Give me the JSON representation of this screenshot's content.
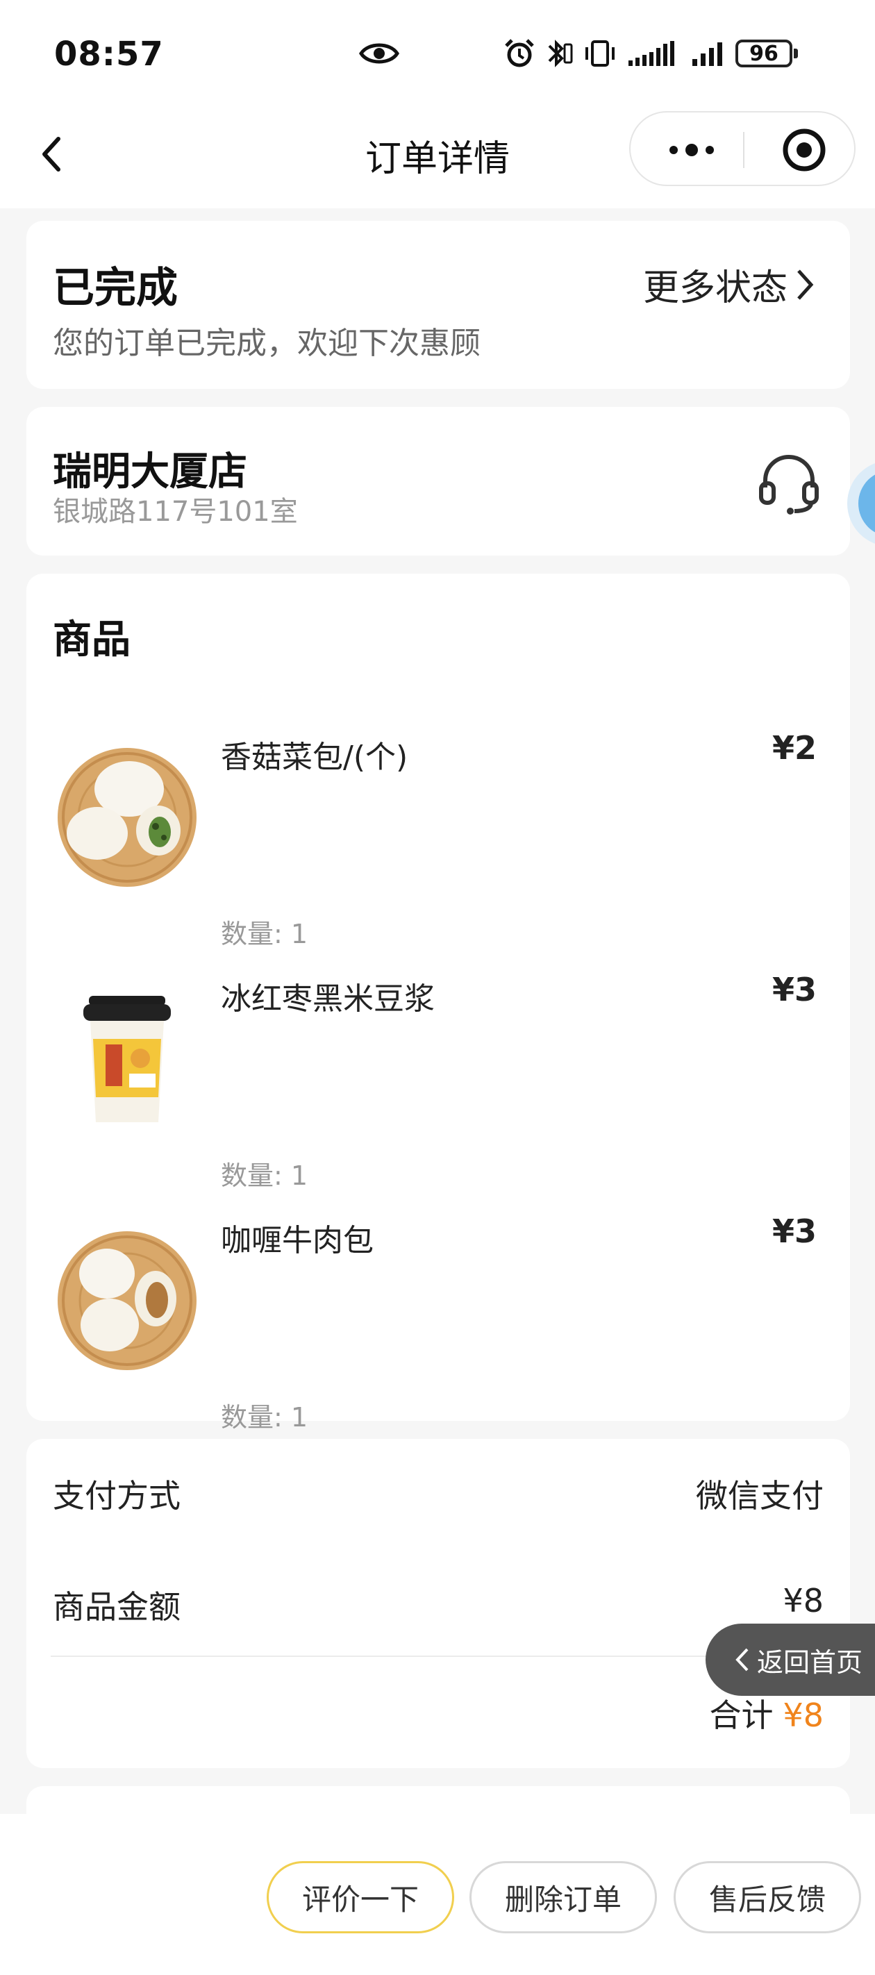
{
  "status_bar": {
    "time": "08:57",
    "battery": "96",
    "icons": [
      "eye-icon",
      "alarm-icon",
      "bluetooth-icon",
      "vibrate-icon",
      "signal-icon",
      "signal-icon",
      "battery-icon"
    ]
  },
  "nav": {
    "title": "订单详情",
    "back_icon": "chevron-left-icon",
    "more_icon": "more-dots-icon",
    "close_icon": "target-icon"
  },
  "order_status": {
    "title": "已完成",
    "subtitle": "您的订单已完成，欢迎下次惠顾",
    "more_label": "更多状态"
  },
  "store": {
    "name": "瑞明大厦店",
    "address": "银城路117号101室",
    "service_icon": "headset-icon"
  },
  "products": {
    "title": "商品",
    "qty_label": "数量:",
    "items": [
      {
        "name": "香菇菜包/(个)",
        "price": "¥2",
        "qty": "1",
        "image": "steamed-buns-vegetable"
      },
      {
        "name": "冰红枣黑米豆浆",
        "price": "¥3",
        "qty": "1",
        "image": "soy-milk-cup"
      },
      {
        "name": "咖喱牛肉包",
        "price": "¥3",
        "qty": "1",
        "image": "steamed-buns-beef"
      }
    ]
  },
  "payment": {
    "method_label": "支付方式",
    "method_value": "微信支付",
    "amount_label": "商品金额",
    "amount_value": "¥8",
    "total_label": "合计",
    "total_value": "¥8"
  },
  "float": {
    "home_label": "返回首页"
  },
  "actions": {
    "review": "评价一下",
    "delete": "删除订单",
    "after_sales": "售后反馈"
  },
  "colors": {
    "accent_total": "#f0841c",
    "review_border": "#f1cf4f",
    "background": "#f6f6f6"
  }
}
